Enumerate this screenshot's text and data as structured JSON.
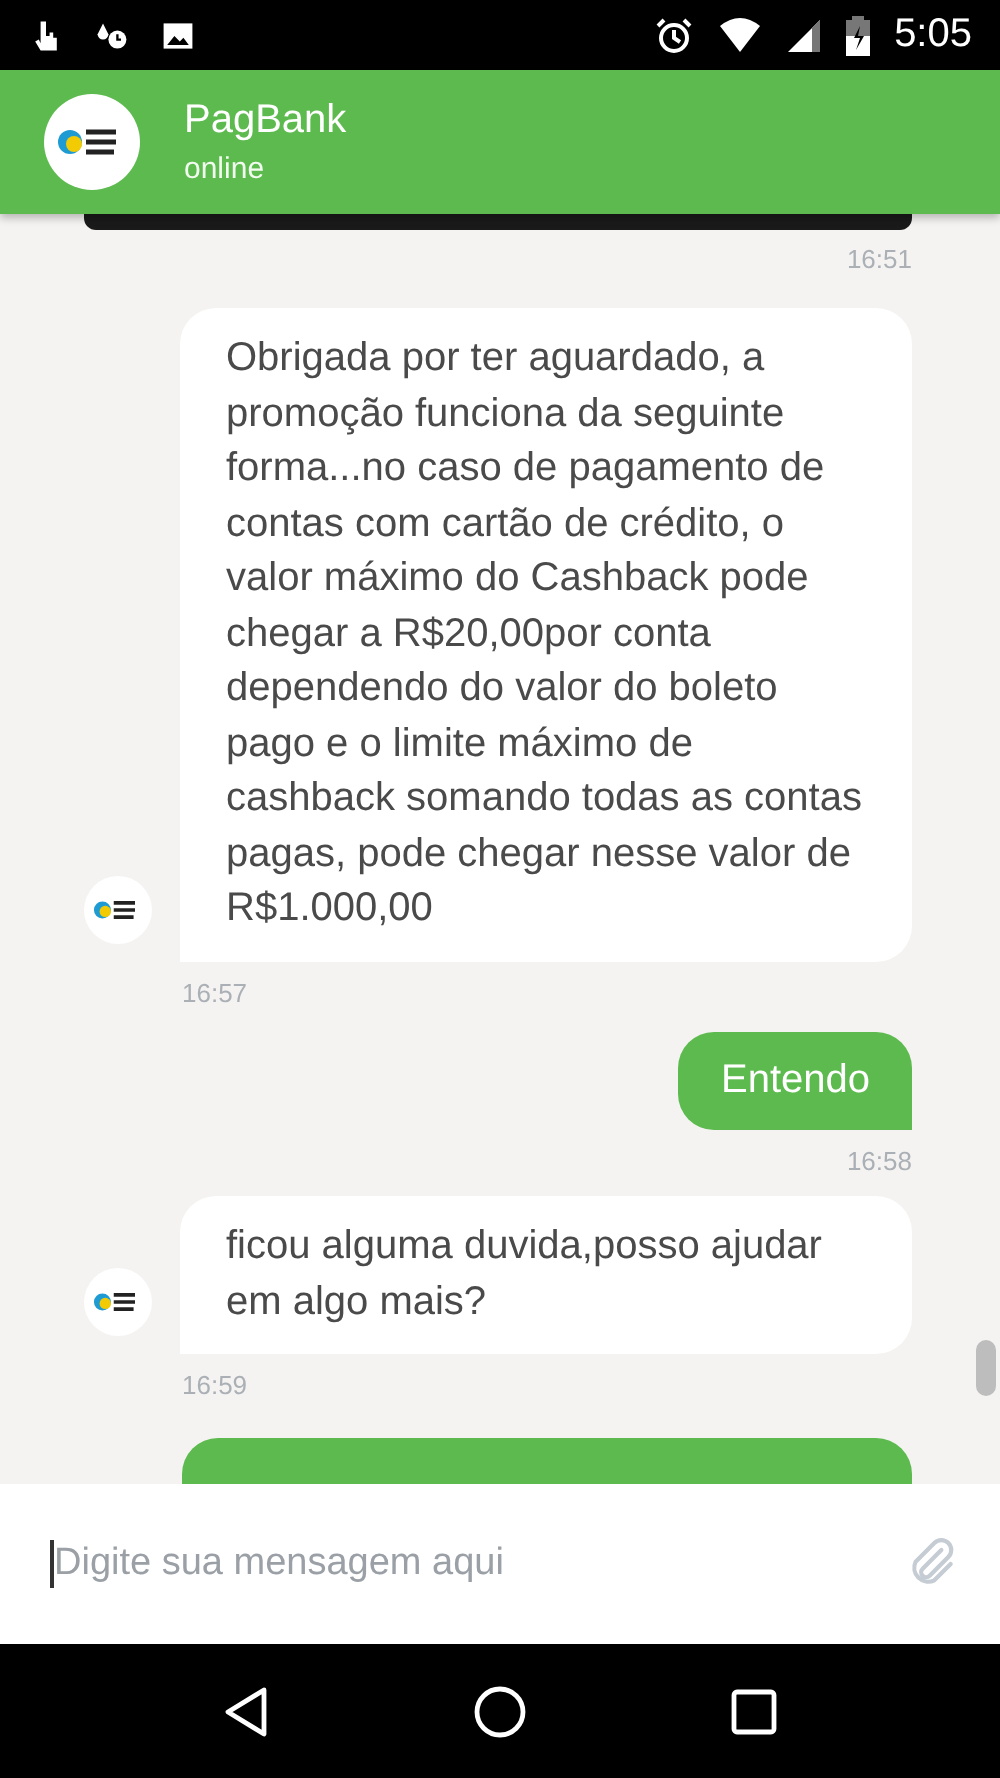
{
  "status_bar": {
    "time": "5:05"
  },
  "header": {
    "title": "PagBank",
    "status": "online"
  },
  "messages": [
    {
      "kind": "edge",
      "time": "16:51"
    },
    {
      "kind": "bot",
      "text": "Obrigada por ter aguardado, a promoção funciona da seguinte forma...no caso de pagamento de contas com cartão de crédito, o valor máximo do Cashback pode chegar a R$20,00por conta dependendo do valor do boleto pago e o limite máximo de cashback somando todas as contas pagas, pode chegar nesse valor de R$1.000,00",
      "time": "16:57"
    },
    {
      "kind": "user",
      "text": "Entendo",
      "time": "16:58"
    },
    {
      "kind": "bot",
      "text": "ficou alguma duvida,posso ajudar em algo mais?",
      "time": "16:59"
    },
    {
      "kind": "stub"
    }
  ],
  "composer": {
    "placeholder": "Digite sua mensagem aqui"
  }
}
